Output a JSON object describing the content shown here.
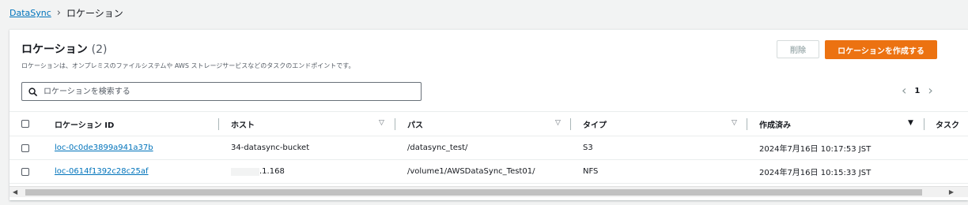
{
  "breadcrumb": {
    "root": "DataSync",
    "current": "ロケーション"
  },
  "header": {
    "title": "ロケーション",
    "count": "(2)",
    "description": "ロケーションは、オンプレミスのファイルシステムや AWS ストレージサービスなどのタスクのエンドポイントです。",
    "delete_label": "削除",
    "create_label": "ロケーションを作成する"
  },
  "search": {
    "placeholder": "ロケーションを検索する",
    "icon": "search-icon"
  },
  "pagination": {
    "current_page": "1"
  },
  "table": {
    "columns": [
      "ロケーション ID",
      "ホスト",
      "パス",
      "タイプ",
      "作成済み",
      "タスク"
    ],
    "rows": [
      {
        "id": "loc-0c0de3899a941a37b",
        "host": "34-datasync-bucket",
        "path": "/datasync_test/",
        "type": "S3",
        "created": "2024年7月16日 10:17:53 JST"
      },
      {
        "id": "loc-0614f1392c28c25af",
        "host": ".1.168",
        "path": "/volume1/AWSDataSync_Test01/",
        "type": "NFS",
        "created": "2024年7月16日 10:15:33 JST"
      }
    ]
  },
  "colors": {
    "primary": "#ec7211",
    "link": "#0073bb",
    "background": "#f2f3f3"
  }
}
